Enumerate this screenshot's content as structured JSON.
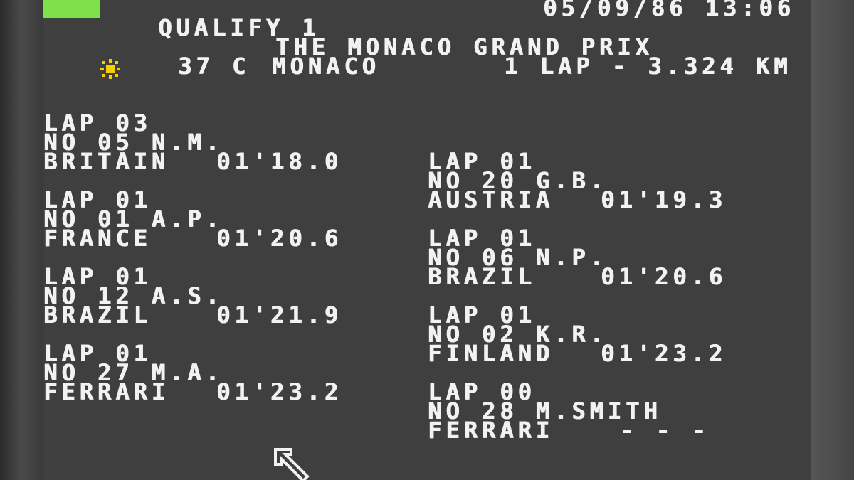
{
  "header": {
    "status_color": "#7fe04a",
    "datetime": "05/09/86 13:06",
    "session": "QUALIFY 1",
    "race_name": "THE MONACO GRAND PRIX",
    "weather_icon": "sun-icon",
    "temperature": "37 C",
    "circuit": "MONACO",
    "lap_info": "1 LAP - 3.324 KM"
  },
  "results": {
    "left": [
      {
        "lap": "LAP 03",
        "driver": "NO 05 N.M.",
        "team": "BRITAIN",
        "time": "01'18.0"
      },
      {
        "lap": "LAP 01",
        "driver": "NO 01 A.P.",
        "team": "FRANCE",
        "time": "01'20.6"
      },
      {
        "lap": "LAP 01",
        "driver": "NO 12 A.S.",
        "team": "BRAZIL",
        "time": "01'21.9"
      },
      {
        "lap": "LAP 01",
        "driver": "NO 27 M.A.",
        "team": "FERRARI",
        "time": "01'23.2"
      }
    ],
    "right": [
      {
        "lap": "LAP 01",
        "driver": "NO 20 G.B.",
        "team": "AUSTRIA",
        "time": "01'19.3"
      },
      {
        "lap": "LAP 01",
        "driver": "NO 06 N.P.",
        "team": "BRAZIL",
        "time": "01'20.6"
      },
      {
        "lap": "LAP 01",
        "driver": "NO 02 K.R.",
        "team": "FINLAND",
        "time": "01'23.2"
      },
      {
        "lap": "LAP 00",
        "driver": "NO 28 M.SMITH",
        "team": "FERRARI",
        "time": "- - -"
      }
    ]
  },
  "cursor_icon": "arrow-cursor-icon"
}
